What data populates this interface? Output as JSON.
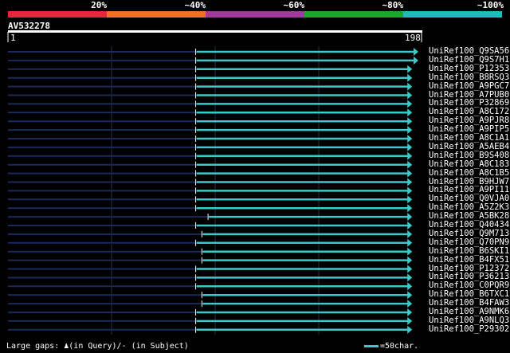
{
  "header": {
    "percent_labels": [
      "20%",
      "~40%",
      "~60%",
      "~80%",
      "~100%"
    ],
    "band_colors": [
      "#e8253a",
      "#e8742b",
      "#a23a9d",
      "#1fa52a",
      "#1fbcbf"
    ]
  },
  "query": {
    "id": "AV532278",
    "start": "1",
    "end": "198"
  },
  "colors": {
    "background": "#000000",
    "hit_line": "#3bc9c9",
    "track_line": "#1a2a5a",
    "gridline": "#2a3040",
    "query_bar": "#ffffff"
  },
  "hits": [
    {
      "name": "UniRef100_Q9SA56",
      "start": 92,
      "end": 198
    },
    {
      "name": "UniRef100_Q9S7H1",
      "start": 92,
      "end": 198
    },
    {
      "name": "UniRef100_P12353",
      "start": 92,
      "end": 195
    },
    {
      "name": "UniRef100_B8RSQ3",
      "start": 92,
      "end": 195
    },
    {
      "name": "UniRef100_A9PGC7",
      "start": 92,
      "end": 195
    },
    {
      "name": "UniRef100_A7PUB0",
      "start": 92,
      "end": 195
    },
    {
      "name": "UniRef100_P32869",
      "start": 92,
      "end": 195
    },
    {
      "name": "UniRef100_A8C172",
      "start": 92,
      "end": 195
    },
    {
      "name": "UniRef100_A9PJR8",
      "start": 92,
      "end": 195
    },
    {
      "name": "UniRef100_A9PIP5",
      "start": 92,
      "end": 195
    },
    {
      "name": "UniRef100_A8C1A1",
      "start": 92,
      "end": 195
    },
    {
      "name": "UniRef100_A5AEB4",
      "start": 92,
      "end": 195
    },
    {
      "name": "UniRef100_B9S408",
      "start": 92,
      "end": 195
    },
    {
      "name": "UniRef100_A8C183",
      "start": 92,
      "end": 195
    },
    {
      "name": "UniRef100_A8C1B5",
      "start": 92,
      "end": 195
    },
    {
      "name": "UniRef100_B9HJW7",
      "start": 92,
      "end": 195
    },
    {
      "name": "UniRef100_A9PI11",
      "start": 92,
      "end": 195
    },
    {
      "name": "UniRef100_Q0VJA0",
      "start": 92,
      "end": 195
    },
    {
      "name": "UniRef100_A5Z2K3",
      "start": 92,
      "end": 195
    },
    {
      "name": "UniRef100_A5BK28",
      "start": 98,
      "end": 195
    },
    {
      "name": "UniRef100_Q40434",
      "start": 92,
      "end": 195
    },
    {
      "name": "UniRef100_Q9M713",
      "start": 95,
      "end": 195
    },
    {
      "name": "UniRef100_Q70PN9",
      "start": 92,
      "end": 195
    },
    {
      "name": "UniRef100_B6SKI1",
      "start": 95,
      "end": 195
    },
    {
      "name": "UniRef100_B4FX51",
      "start": 95,
      "end": 195
    },
    {
      "name": "UniRef100_P12372",
      "start": 92,
      "end": 195
    },
    {
      "name": "UniRef100_P36213",
      "start": 92,
      "end": 195
    },
    {
      "name": "UniRef100_C0PQR9",
      "start": 92,
      "end": 195
    },
    {
      "name": "UniRef100_B6TXC1",
      "start": 95,
      "end": 195
    },
    {
      "name": "UniRef100_B4FAW3",
      "start": 95,
      "end": 195
    },
    {
      "name": "UniRef100_A9NMK6",
      "start": 92,
      "end": 195
    },
    {
      "name": "UniRef100_A9NLQ3",
      "start": 92,
      "end": 195
    },
    {
      "name": "UniRef100_P29302",
      "start": 92,
      "end": 195
    }
  ],
  "footer": {
    "large_gaps": "Large gaps: ",
    "in_query": "(in Query)/",
    "in_subject": " (in Subject)",
    "legend_label": "=50char."
  }
}
